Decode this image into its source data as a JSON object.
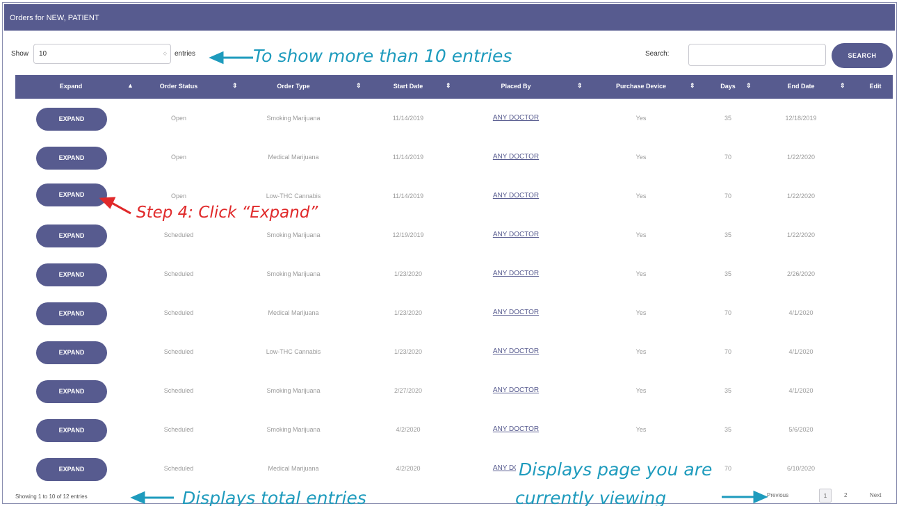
{
  "window": {
    "title": "Orders for NEW, PATIENT"
  },
  "length_control": {
    "show_label": "Show",
    "value": "10",
    "entries_label": "entries"
  },
  "search": {
    "label": "Search:",
    "value": "",
    "button_label": "SEARCH"
  },
  "table": {
    "columns": [
      "Expand",
      "Order Status",
      "Order Type",
      "Start Date",
      "Placed By",
      "Purchase Device",
      "Days",
      "End Date",
      "Edit"
    ],
    "sort_icons": {
      "expand": "▲",
      "other": "⇕"
    },
    "rows": [
      {
        "expand": "EXPAND",
        "status": "Open",
        "type": "Smoking Marijuana",
        "start": "11/14/2019",
        "placed_by": "ANY DOCTOR",
        "device": "Yes",
        "days": "35",
        "end": "12/18/2019",
        "edit": ""
      },
      {
        "expand": "EXPAND",
        "status": "Open",
        "type": "Medical Marijuana",
        "start": "11/14/2019",
        "placed_by": "ANY DOCTOR",
        "device": "Yes",
        "days": "70",
        "end": "1/22/2020",
        "edit": ""
      },
      {
        "expand": "EXPAND",
        "status": "Open",
        "type": "Low-THC Cannabis",
        "start": "11/14/2019",
        "placed_by": "ANY DOCTOR",
        "device": "Yes",
        "days": "70",
        "end": "1/22/2020",
        "edit": ""
      },
      {
        "expand": "EXPAND",
        "status": "Scheduled",
        "type": "Smoking Marijuana",
        "start": "12/19/2019",
        "placed_by": "ANY DOCTOR",
        "device": "Yes",
        "days": "35",
        "end": "1/22/2020",
        "edit": ""
      },
      {
        "expand": "EXPAND",
        "status": "Scheduled",
        "type": "Smoking Marijuana",
        "start": "1/23/2020",
        "placed_by": "ANY DOCTOR",
        "device": "Yes",
        "days": "35",
        "end": "2/26/2020",
        "edit": ""
      },
      {
        "expand": "EXPAND",
        "status": "Scheduled",
        "type": "Medical Marijuana",
        "start": "1/23/2020",
        "placed_by": "ANY DOCTOR",
        "device": "Yes",
        "days": "70",
        "end": "4/1/2020",
        "edit": ""
      },
      {
        "expand": "EXPAND",
        "status": "Scheduled",
        "type": "Low-THC Cannabis",
        "start": "1/23/2020",
        "placed_by": "ANY DOCTOR",
        "device": "Yes",
        "days": "70",
        "end": "4/1/2020",
        "edit": ""
      },
      {
        "expand": "EXPAND",
        "status": "Scheduled",
        "type": "Smoking Marijuana",
        "start": "2/27/2020",
        "placed_by": "ANY DOCTOR",
        "device": "Yes",
        "days": "35",
        "end": "4/1/2020",
        "edit": ""
      },
      {
        "expand": "EXPAND",
        "status": "Scheduled",
        "type": "Smoking Marijuana",
        "start": "4/2/2020",
        "placed_by": "ANY DOCTOR",
        "device": "Yes",
        "days": "35",
        "end": "5/6/2020",
        "edit": ""
      },
      {
        "expand": "EXPAND",
        "status": "Scheduled",
        "type": "Medical Marijuana",
        "start": "4/2/2020",
        "placed_by": "ANY DOCTOR",
        "device": "Yes",
        "days": "70",
        "end": "6/10/2020",
        "edit": ""
      }
    ]
  },
  "footer": {
    "info": "Showing 1 to 10 of 12 entries",
    "pagination": {
      "previous": "Previous",
      "pages": [
        "1",
        "2"
      ],
      "current": "1",
      "next": "Next"
    }
  },
  "annotations": {
    "entries_hint": "To show more than 10 entries",
    "step4": "Step 4: Click “Expand”",
    "total_hint": "Displays total entries",
    "page_hint_line1": "Displays page you are",
    "page_hint_line2": "currently viewing"
  },
  "colors": {
    "primary": "#575b8f",
    "annotation_cyan": "#1e9bbd",
    "annotation_red": "#e0292a"
  }
}
